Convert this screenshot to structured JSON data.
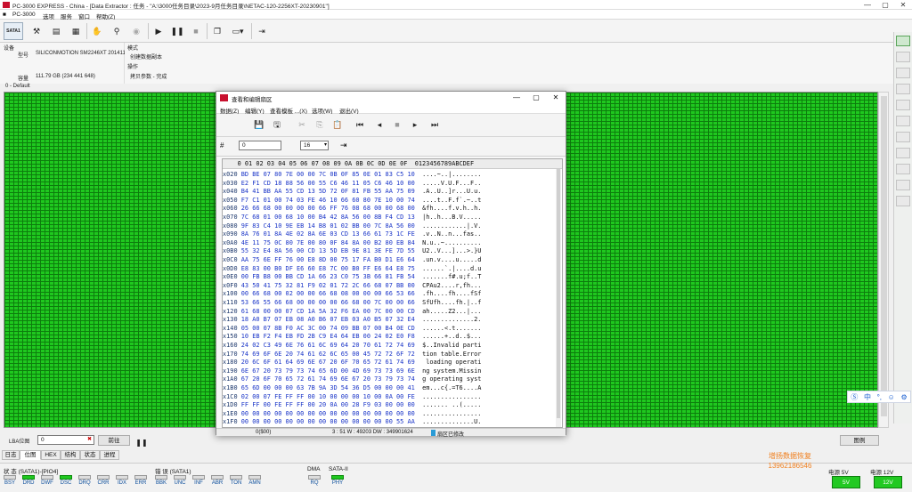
{
  "app": {
    "title": "PC-3000 EXPRESS - China - [Data Extractor : 任务 - \"A:\\3000任务目录\\2023-9月任务目录\\NETAC-120-2256XT-20230901\"]",
    "subtitle": "PC-3000"
  },
  "menu": [
    "选项",
    "服务",
    "窗口",
    "帮助(Z)"
  ],
  "toolbar": {
    "sata_label": "SATA1"
  },
  "info": {
    "device_label": "设备",
    "model_label": "型号",
    "model_value": "SILICONMOTION SM2246XT 2014112...",
    "capacity_label": "容量",
    "capacity_value": "111.79 GB (234 441 648)",
    "mode_label": "模式",
    "mode_value": "创建数据副本",
    "op_label": "操作",
    "op_value": "拷贝参数 - 完成"
  },
  "map_header": "0 - Default",
  "lba": {
    "label": "LBA位图",
    "value": "0",
    "forward_button": "前往",
    "legend_button": "图例"
  },
  "bottom_tabs": [
    "日志",
    "位图",
    "HEX",
    "结构",
    "状态",
    "进程"
  ],
  "status": {
    "state_group": "状 态 (SATA1)-[PIO4]",
    "error_group": "错 误 (SATA1)",
    "dma_group": "DMA",
    "sata_group": "SATA-II",
    "state_indicators": [
      {
        "name": "BSY",
        "on": false
      },
      {
        "name": "DRD",
        "on": true
      },
      {
        "name": "DWF",
        "on": false
      },
      {
        "name": "DSC",
        "on": true
      },
      {
        "name": "DRQ",
        "on": false
      },
      {
        "name": "CRR",
        "on": false
      },
      {
        "name": "IDX",
        "on": false
      },
      {
        "name": "ERR",
        "on": false
      }
    ],
    "error_indicators": [
      {
        "name": "BBK",
        "on": false
      },
      {
        "name": "UNC",
        "on": false
      },
      {
        "name": "INF",
        "on": false
      },
      {
        "name": "ABR",
        "on": false
      },
      {
        "name": "TON",
        "on": false
      },
      {
        "name": "AMN",
        "on": false
      }
    ],
    "dma_indicator": {
      "name": "RQ",
      "on": false
    },
    "sata_indicator": {
      "name": "PHY",
      "on": true
    },
    "power5_label": "电源 5V",
    "power5_value": "5V",
    "power12_label": "电源 12V",
    "power12_value": "12V"
  },
  "watermark": {
    "line1": "增扬数据恢复",
    "line2": "13962186546"
  },
  "ime": [
    "中",
    "°,",
    "☺",
    "⚙"
  ],
  "dialog": {
    "title": "查看和编辑扇区",
    "menu": [
      "数据(Z)",
      "编辑(Y)",
      "查看模板 ...(X)",
      "选项(W)",
      "退出(V)"
    ],
    "offset_value": "0",
    "radix_value": "16",
    "hex_header": "    0 01 02 03 04 05 06 07 08 09 0A 0B 0C 0D 0E 0F  0123456789ABCDEF",
    "rows": [
      {
        "off": "x020",
        "hex": "BD BE 07 80 7E 00 00 7C 0B 0F 85 0E 01 83 C5 10",
        "asc": "....~..|........"
      },
      {
        "off": "x030",
        "hex": "E2 F1 CD 18 88 56 00 55 C6 46 11 05 C6 46 10 00",
        "asc": ".....V.U.F...F.."
      },
      {
        "off": "x040",
        "hex": "B4 41 BB AA 55 CD 13 5D 72 0F 81 FB 55 AA 75 09",
        "asc": ".A..U..]r...U.u."
      },
      {
        "off": "x050",
        "hex": "F7 C1 01 00 74 03 FE 46 10 66 60 80 7E 10 00 74",
        "asc": "....t..F.f`.~..t"
      },
      {
        "off": "x060",
        "hex": "26 66 68 00 00 00 00 66 FF 76 08 68 00 00 68 00",
        "asc": "&fh....f.v.h..h."
      },
      {
        "off": "x070",
        "hex": "7C 68 01 00 68 10 00 B4 42 8A 56 00 8B F4 CD 13",
        "asc": "|h..h...B.V....."
      },
      {
        "off": "x080",
        "hex": "9F 83 C4 10 9E EB 14 B8 01 02 BB 00 7C 8A 56 00",
        "asc": "............|.V."
      },
      {
        "off": "x090",
        "hex": "8A 76 01 8A 4E 02 8A 6E 03 CD 13 66 61 73 1C FE",
        "asc": ".v..N..n...fas.."
      },
      {
        "off": "x0A0",
        "hex": "4E 11 75 0C 80 7E 00 80 0F 84 8A 00 B2 80 EB 84",
        "asc": "N.u..~.........."
      },
      {
        "off": "x0B0",
        "hex": "55 32 E4 8A 56 00 CD 13 5D EB 9E 81 3E FE 7D 55",
        "asc": "U2..V...]...>.}U"
      },
      {
        "off": "x0C0",
        "hex": "AA 75 6E FF 76 00 E8 8D 00 75 17 FA B0 D1 E6 64",
        "asc": ".un.v....u.....d"
      },
      {
        "off": "x0D0",
        "hex": "E8 83 00 B0 DF E6 60 E8 7C 00 B0 FF E6 64 E8 75",
        "asc": "......`.|....d.u"
      },
      {
        "off": "x0E0",
        "hex": "00 FB B8 00 BB CD 1A 66 23 C0 75 3B 66 81 FB 54",
        "asc": ".......f#.u;f..T"
      },
      {
        "off": "x0F0",
        "hex": "43 50 41 75 32 81 F9 02 01 72 2C 66 68 07 BB 00",
        "asc": "CPAu2....r,fh..."
      },
      {
        "off": "x100",
        "hex": "00 66 68 00 02 00 00 66 68 08 00 00 00 66 53 66",
        "asc": ".fh....fh....fSf"
      },
      {
        "off": "x110",
        "hex": "53 66 55 66 68 00 00 00 00 66 68 00 7C 00 00 66",
        "asc": "SfUfh....fh.|..f"
      },
      {
        "off": "x120",
        "hex": "61 68 00 00 07 CD 1A 5A 32 F6 EA 00 7C 00 00 CD",
        "asc": "ah.....Z2...|..."
      },
      {
        "off": "x130",
        "hex": "18 A0 B7 07 EB 08 A0 B6 07 EB 03 A0 B5 07 32 E4",
        "asc": "..............2."
      },
      {
        "off": "x140",
        "hex": "05 00 07 8B F0 AC 3C 00 74 09 BB 07 00 B4 0E CD",
        "asc": "......<.t......."
      },
      {
        "off": "x150",
        "hex": "10 EB F2 F4 EB FD 2B C9 E4 64 EB 00 24 02 E0 F8",
        "asc": "......+..d..$..."
      },
      {
        "off": "x160",
        "hex": "24 02 C3 49 6E 76 61 6C 69 64 20 70 61 72 74 69",
        "asc": "$..Invalid parti"
      },
      {
        "off": "x170",
        "hex": "74 69 6F 6E 20 74 61 62 6C 65 00 45 72 72 6F 72",
        "asc": "tion table.Error"
      },
      {
        "off": "x180",
        "hex": "20 6C 6F 61 64 69 6E 67 20 6F 70 65 72 61 74 69",
        "asc": " loading operati"
      },
      {
        "off": "x190",
        "hex": "6E 67 20 73 79 73 74 65 6D 00 4D 69 73 73 69 6E",
        "asc": "ng system.Missin"
      },
      {
        "off": "x1A0",
        "hex": "67 20 6F 70 65 72 61 74 69 6E 67 20 73 79 73 74",
        "asc": "g operating syst"
      },
      {
        "off": "x1B0",
        "hex": "65 6D 00 00 00 63 7B 9A 3D 54 36 D5 00 00 00 41",
        "asc": "em...c{.=T6....A"
      },
      {
        "off": "x1C0",
        "hex": "02 00 07 FE FF FF 00 10 00 00 00 10 00 0A 00 FE",
        "asc": "................"
      },
      {
        "off": "x1D0",
        "hex": "FF FF 00 FE FF FF 00 20 0A 00 28 F9 03 00 00 00",
        "asc": "....... ..(....."
      },
      {
        "off": "x1E0",
        "hex": "00 00 00 00 00 00 00 00 00 00 00 00 00 00 00 00",
        "asc": "................"
      },
      {
        "off": "x1F0",
        "hex": "00 00 00 00 00 00 00 00 00 00 00 00 00 00 55 AA",
        "asc": "..............U."
      }
    ],
    "status_left": "0($00)",
    "status_mid": "3 : 51 W : 49203 DW : 349901624",
    "status_right": "扇区已修改"
  }
}
